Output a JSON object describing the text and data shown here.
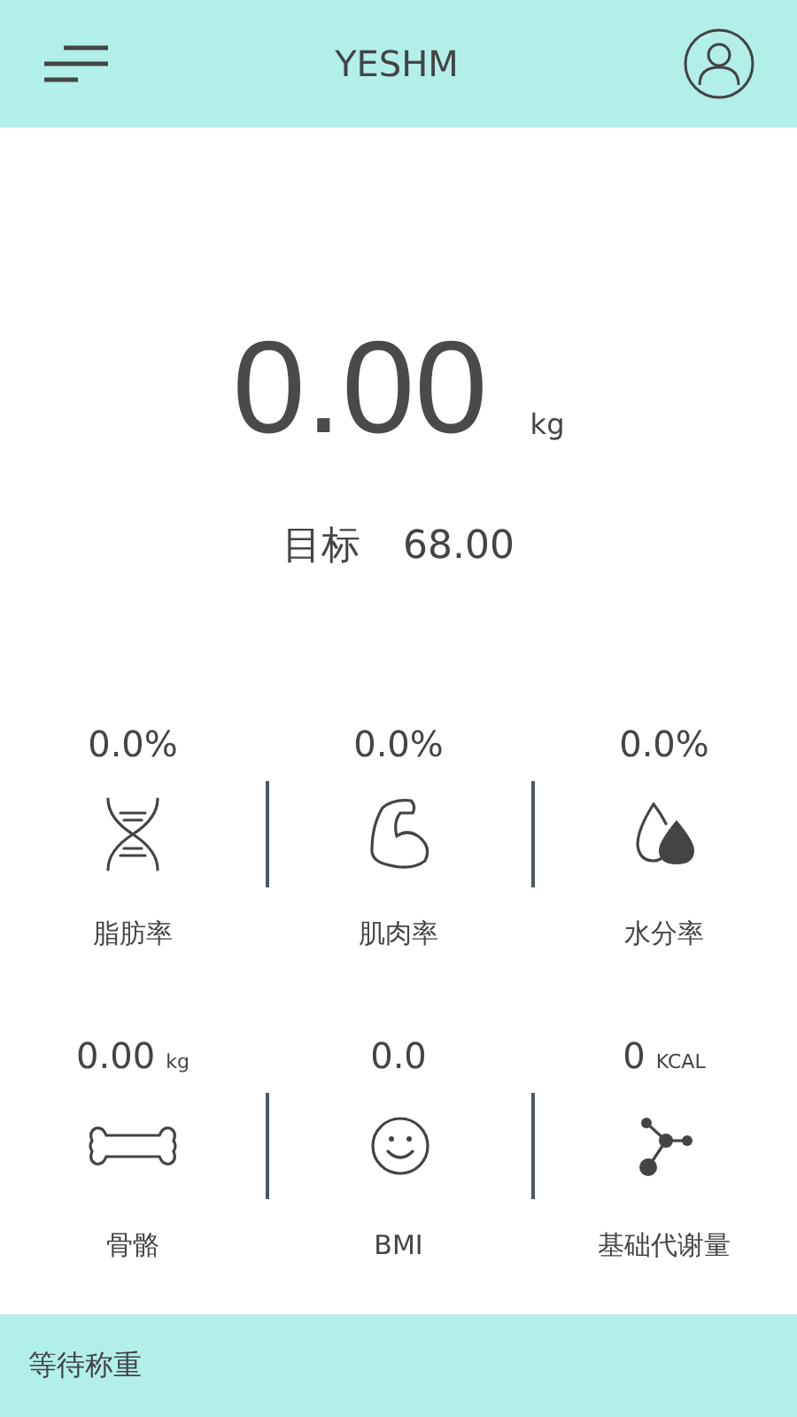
{
  "header": {
    "title": "YESHM"
  },
  "weight": {
    "value": "0.00",
    "unit": "kg",
    "target_label": "目标",
    "target_value": "68.00"
  },
  "metrics": [
    {
      "kind": "dna",
      "value": "0.0%",
      "label": "脂肪率"
    },
    {
      "kind": "muscle",
      "value": "0.0%",
      "label": "肌肉率"
    },
    {
      "kind": "drops",
      "value": "0.0%",
      "label": "水分率"
    },
    {
      "kind": "bone",
      "value": "0.00",
      "unit": "kg",
      "label": "骨骼"
    },
    {
      "kind": "smile",
      "value": "0.0",
      "label": "BMI"
    },
    {
      "kind": "molecule",
      "value": "0",
      "unit": "KCAL",
      "label": "基础代谢量"
    }
  ],
  "status_bar": {
    "text": "等待称重"
  }
}
